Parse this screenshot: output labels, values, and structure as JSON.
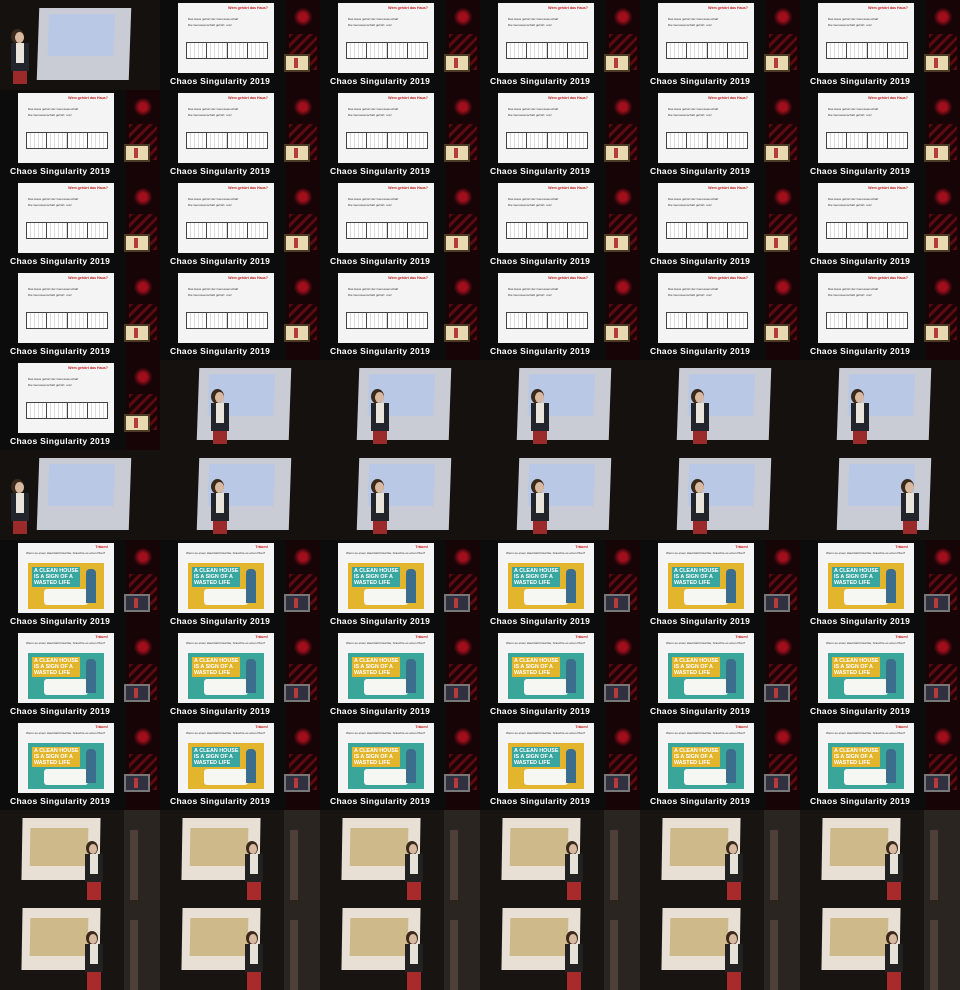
{
  "sheet": {
    "columns": 6,
    "rows": 11
  },
  "caption": "Chaos  Singularity  2019",
  "slide_comic": {
    "title": "Wem gehört das Haus?",
    "bullets": [
      "Das Haus gehört der Genossenschaft",
      "Die Genossenschaft gehört: uns!"
    ]
  },
  "slide_poster": {
    "title": "Träum!",
    "subtitle": "Wenn es einen Haushalt bräuchte, bräuchte es einen Plan?",
    "poster_text": "A CLEAN HOUSE\nIS A SIGN OF A\nWASTED LIFE"
  },
  "frames": [
    "talk-left",
    "comic",
    "comic",
    "comic",
    "comic",
    "comic",
    "comic",
    "comic",
    "comic",
    "comic",
    "comic",
    "comic",
    "comic",
    "comic",
    "comic",
    "comic",
    "comic",
    "comic",
    "comic",
    "comic",
    "comic",
    "comic",
    "comic",
    "comic",
    "comic",
    "talk",
    "talk",
    "talk",
    "talk",
    "talk",
    "talk-left",
    "talk",
    "talk",
    "talk",
    "talk",
    "talk-right",
    "poster",
    "poster",
    "poster",
    "poster",
    "poster",
    "poster",
    "poster2",
    "poster2",
    "poster2",
    "poster2",
    "poster2",
    "poster2",
    "poster2",
    "poster",
    "poster2",
    "poster",
    "poster2",
    "poster2",
    "hall",
    "hall",
    "hall",
    "hall",
    "hall",
    "hall",
    "hall",
    "hall",
    "hall",
    "hall",
    "hall",
    "hall"
  ]
}
